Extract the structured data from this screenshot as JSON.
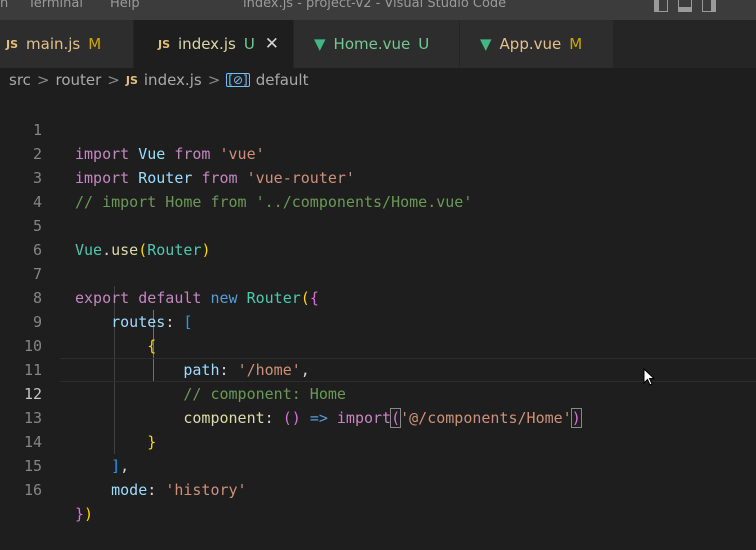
{
  "titlebar": {
    "menu_partial": "n",
    "menu_terminal": "Terminal",
    "menu_help": "Help",
    "title": "index.js - project-v2 - Visual Studio Code"
  },
  "tabs": [
    {
      "icon": "JS",
      "label": "main.js",
      "badge": "M"
    },
    {
      "icon": "JS",
      "label": "index.js",
      "badge": "U",
      "close": "✕"
    },
    {
      "icon": "▼",
      "label": "Home.vue",
      "badge": "U"
    },
    {
      "icon": "▼",
      "label": "App.vue",
      "badge": "M"
    }
  ],
  "breadcrumb": {
    "folder1": "src",
    "folder2": "router",
    "file_icon": "JS",
    "file": "index.js",
    "symbol_icon": "[⊘]",
    "symbol": "default",
    "sep": ">"
  },
  "code": {
    "line_numbers": [
      "1",
      "2",
      "3",
      "4",
      "5",
      "6",
      "7",
      "8",
      "9",
      "10",
      "11",
      "12",
      "13",
      "14",
      "15",
      "16"
    ],
    "l1": {
      "a": "import",
      "b": "Vue",
      "c": "from",
      "d": "'vue'"
    },
    "l2": {
      "a": "import",
      "b": "Router",
      "c": "from",
      "d": "'vue-router'"
    },
    "l3": {
      "comment": "// import Home from '../components/Home.vue'"
    },
    "l5": {
      "a": "Vue",
      "b": ".",
      "c": "use",
      "d": "(",
      "e": "Router",
      "f": ")"
    },
    "l7": {
      "a": "export",
      "b": "default",
      "c": "new",
      "d": "Router",
      "e": "(",
      "f": "{"
    },
    "l8": {
      "a": "routes",
      "b": ":",
      "c": "["
    },
    "l9": {
      "a": "{"
    },
    "l10": {
      "a": "path",
      "b": ":",
      "c": "'/home'",
      "d": ","
    },
    "l11": {
      "comment": "// component: Home"
    },
    "l12": {
      "a": "component",
      "b": ":",
      "c": "()",
      "d": "=>",
      "e": "import",
      "f": "(",
      "g": "'@/components/Home'",
      "h": ")"
    },
    "l13": {
      "a": "}"
    },
    "l14": {
      "a": "]",
      "b": ","
    },
    "l15": {
      "a": "mode",
      "b": ":",
      "c": "'history'"
    },
    "l16": {
      "a": "}",
      "b": ")"
    }
  },
  "colors": {
    "background": "#1e1e1e",
    "keyword_control": "#c586c0",
    "keyword": "#569cd6",
    "variable": "#9cdcfe",
    "class": "#4ec9b0",
    "function": "#dcdcaa",
    "string": "#ce9178",
    "comment": "#6a9955"
  }
}
